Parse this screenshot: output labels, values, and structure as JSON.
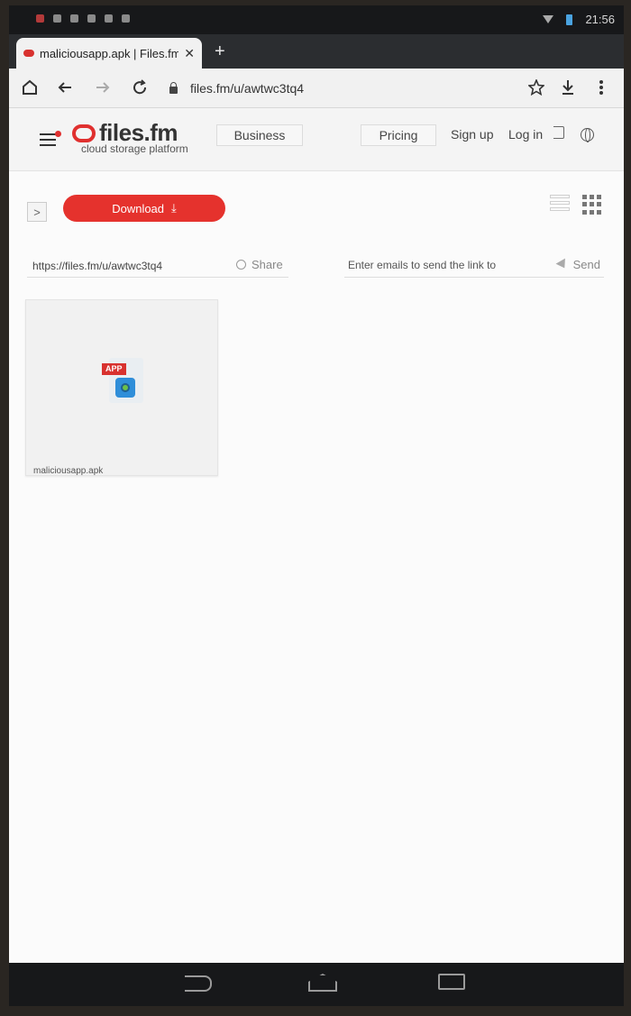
{
  "statusbar": {
    "time": "21:56"
  },
  "browser": {
    "tab_title": "maliciousapp.apk | Files.fm",
    "tab_close": "✕",
    "new_tab": "+",
    "url": "files.fm/u/awtwc3tq4"
  },
  "site": {
    "logo_text": "files.fm",
    "logo_subtitle": "cloud storage platform",
    "nav": {
      "business": "Business",
      "pricing": "Pricing",
      "signup": "Sign up",
      "login": "Log in"
    }
  },
  "actions": {
    "download_label": "Download",
    "download_icon": "⤓",
    "toggle": ">"
  },
  "share": {
    "link": "https://files.fm/u/awtwc3tq4",
    "share_label": "Share",
    "email_placeholder": "Enter emails to send the link to",
    "send_label": "Send"
  },
  "files": [
    {
      "badge": "APP",
      "name": "maliciousapp.apk"
    }
  ],
  "colors": {
    "brand": "#e0302f",
    "download": "#e5322d"
  }
}
